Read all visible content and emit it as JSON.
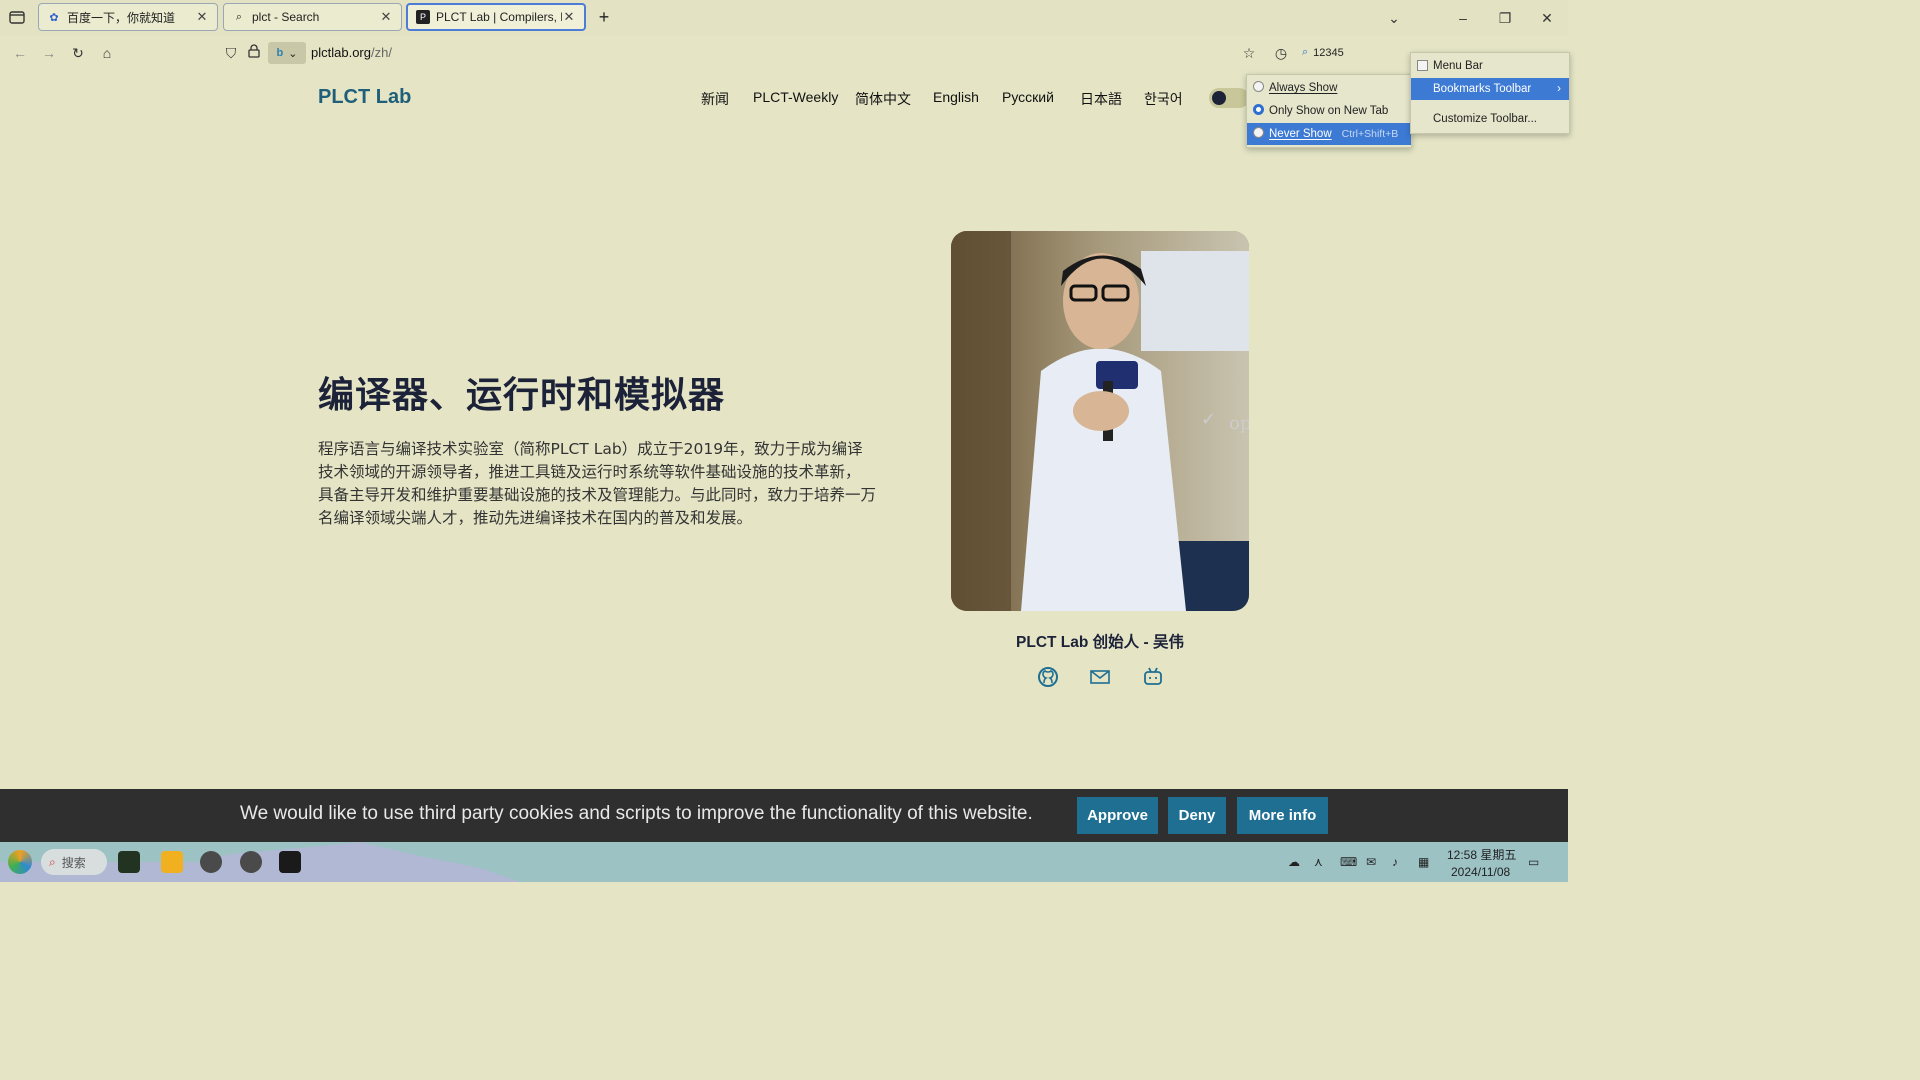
{
  "browser": {
    "tabs": [
      {
        "title": "百度一下，你就知道",
        "active": false
      },
      {
        "title": "plct - Search",
        "active": false
      },
      {
        "title": "PLCT Lab | Compilers, Runt",
        "active": true
      }
    ],
    "new_tab_symbol": "+",
    "url_host": "plctlab.org",
    "url_path": "/zh/",
    "search_text": "12345"
  },
  "site": {
    "logo": "PLCT Lab",
    "nav": [
      "新闻",
      "PLCT-Weekly",
      "简体中文",
      "English",
      "Русский",
      "日本語",
      "한국어"
    ],
    "hero_title": "编译器、运行时和模拟器",
    "hero_desc": "程序语言与编译技术实验室（简称PLCT Lab）成立于2019年，致力于成为编译技术领域的开源领导者，推进工具链及运行时系统等软件基础设施的技术革新， 具备主导开发和维护重要基础设施的技术及管理能力。与此同时，致力于培养一万名编译领域尖端人才，推动先进编译技术在国内的普及和发展。",
    "photo_caption": "PLCT Lab 创始人 - 吴伟",
    "photo_overlay_text": "op"
  },
  "context_menu": {
    "items": [
      {
        "label": "Menu Bar",
        "checked": false
      },
      {
        "label": "Bookmarks Toolbar",
        "submenu": true,
        "highlighted": true
      },
      {
        "label": "Customize Toolbar..."
      }
    ]
  },
  "bookmarks_submenu": {
    "items": [
      {
        "label": "Always Show",
        "selected": false
      },
      {
        "label": "Only Show on New Tab",
        "selected": true
      },
      {
        "label": "Never Show",
        "shortcut": "Ctrl+Shift+B",
        "selected": false,
        "highlighted": true
      }
    ]
  },
  "cookie_banner": {
    "message": "We would like to use third party cookies and scripts to improve the functionality of this website.",
    "approve": "Approve",
    "deny": "Deny",
    "more_info": "More info"
  },
  "taskbar": {
    "search_label": "搜索",
    "time": "12:58 星期五",
    "date": "2024/11/08"
  },
  "colors": {
    "page_bg": "#e5e5c6",
    "accent": "#1f6f92",
    "logo": "#1f5f7a",
    "menu_highlight": "#3d7ad4"
  }
}
